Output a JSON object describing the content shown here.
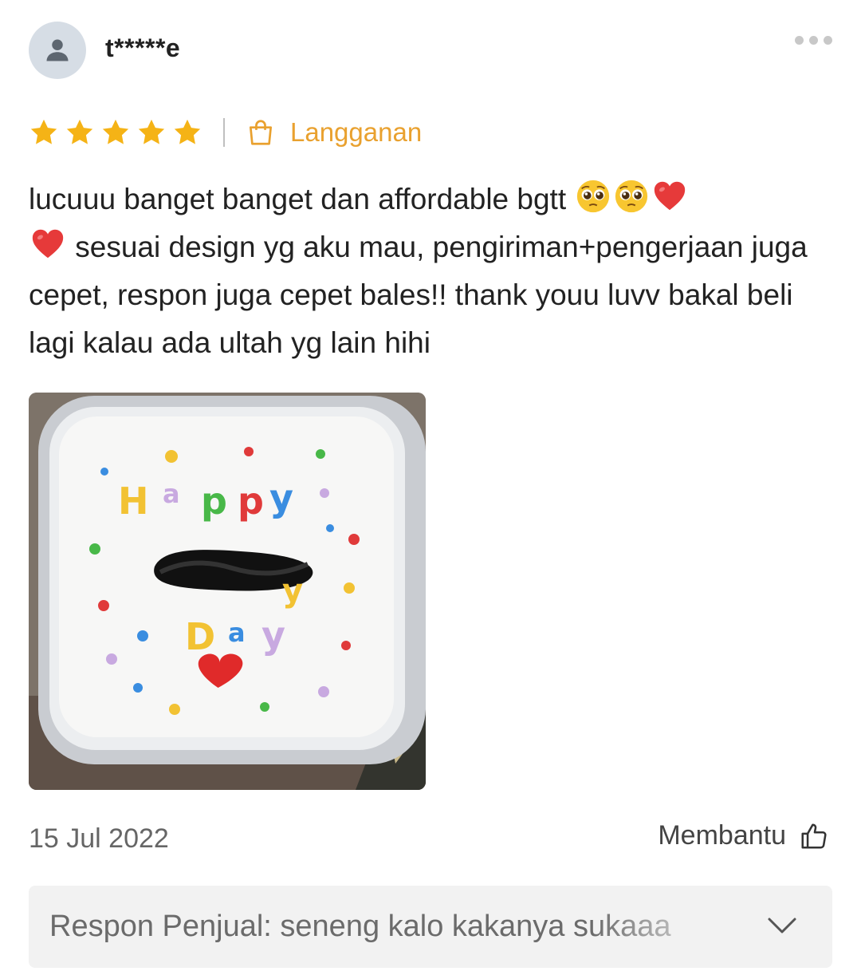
{
  "reviewer": {
    "name": "t*****e",
    "avatar_icon": "user-icon"
  },
  "more_icon": "more-horizontal-icon",
  "rating": {
    "stars": 5,
    "max_stars": 5,
    "star_color": "#f5b316",
    "variant_icon": "shopping-bag-icon",
    "variant_label": "Langganan",
    "variant_color": "#e9a12f"
  },
  "review": {
    "line1": "lucuuu banget banget dan affordable bgtt",
    "line2": " sesuai design yg aku mau, pengiriman+pengerjaan juga cepet, respon juga cepet bales!! thank youu luvv bakal beli lagi kalau ada ultah yg lain hihi",
    "emojis": [
      "pleading-face-emoji",
      "pleading-face-emoji",
      "red-heart-emoji",
      "red-heart-emoji"
    ]
  },
  "photo": {
    "cake_text_top": "Happy",
    "cake_text_bottom": "Day"
  },
  "footer": {
    "date": "15 Jul 2022",
    "helpful_label": "Membantu",
    "helpful_icon": "thumbs-up-icon"
  },
  "seller_response": {
    "text": "Respon Penjual: seneng kalo kakanya sukaaa",
    "expand_icon": "chevron-down-icon"
  }
}
